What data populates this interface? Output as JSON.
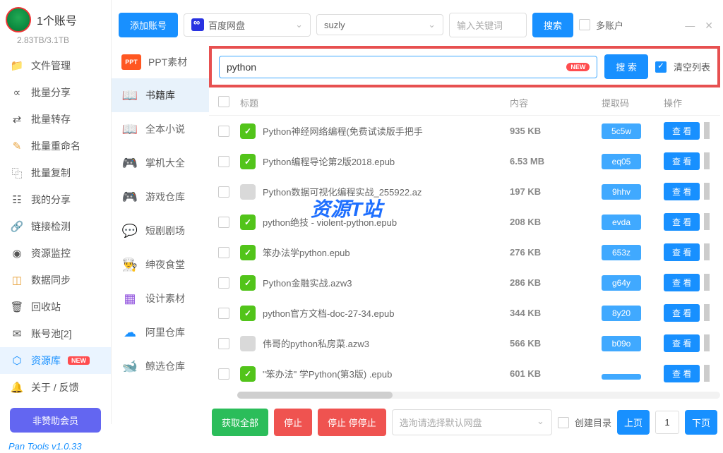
{
  "sidebar": {
    "account_label": "1个账号",
    "storage": "2.83TB/3.1TB",
    "items": [
      {
        "icon": "📁",
        "label": "文件管理",
        "color": "#e8a23c"
      },
      {
        "icon": "∝",
        "label": "批量分享",
        "color": "#555"
      },
      {
        "icon": "⇄",
        "label": "批量转存",
        "color": "#555"
      },
      {
        "icon": "✎",
        "label": "批量重命名",
        "color": "#e8a23c"
      },
      {
        "icon": "⿻",
        "label": "批量复制",
        "color": "#555"
      },
      {
        "icon": "☷",
        "label": "我的分享",
        "color": "#555"
      },
      {
        "icon": "🔗",
        "label": "链接检测",
        "color": "#555"
      },
      {
        "icon": "◉",
        "label": "资源监控",
        "color": "#555"
      },
      {
        "icon": "◫",
        "label": "数据同步",
        "color": "#e8a23c"
      },
      {
        "icon": "🗑",
        "label": "回收站",
        "color": "#555"
      },
      {
        "icon": "✉",
        "label": "账号池[2]",
        "color": "#555"
      },
      {
        "icon": "⬡",
        "label": "资源库",
        "color": "#1890ff",
        "active": true,
        "badge": "NEW"
      },
      {
        "icon": "🔔",
        "label": "关于 / 反馈",
        "color": "#555"
      }
    ],
    "member_btn": "非赞助会员",
    "version": "Pan Tools v1.0.33"
  },
  "categories": [
    {
      "label": "PPT素材",
      "iconColor": "#ff5722",
      "glyph": "PPT"
    },
    {
      "label": "书籍库",
      "iconColor": "#40a9ff",
      "glyph": "📖",
      "active": true
    },
    {
      "label": "全本小说",
      "iconColor": "#555",
      "glyph": "📖"
    },
    {
      "label": "掌机大全",
      "iconColor": "#ffc53d",
      "glyph": "🎮"
    },
    {
      "label": "游戏仓库",
      "iconColor": "#b037d9",
      "glyph": "🎮"
    },
    {
      "label": "短剧剧场",
      "iconColor": "#1890ff",
      "glyph": "💬"
    },
    {
      "label": "绅夜食堂",
      "iconColor": "#d4380d",
      "glyph": "👨‍🍳"
    },
    {
      "label": "设计素材",
      "iconColor": "#9254de",
      "glyph": "▦"
    },
    {
      "label": "阿里仓库",
      "iconColor": "#1890ff",
      "glyph": "☁"
    },
    {
      "label": "鲸选仓库",
      "iconColor": "#52c41a",
      "glyph": "🐋"
    }
  ],
  "topbar": {
    "add_account": "添加账号",
    "drive_label": "百度网盘",
    "user_label": "suzly",
    "keyword_placeholder": "输入关键词",
    "search_btn": "搜索",
    "multi_account": "多账户"
  },
  "search": {
    "value": "python",
    "badge": "NEW",
    "btn": "搜 索",
    "clear_label": "清空列表"
  },
  "table": {
    "headers": {
      "title": "标题",
      "content": "内容",
      "code": "提取码",
      "action": "操作"
    },
    "rows": [
      {
        "title": "Python神经网络编程(免费试读版手把手",
        "size": "935 KB",
        "code": "5c5w",
        "view": "查 看",
        "icon": "green"
      },
      {
        "title": "Python编程导论第2版2018.epub",
        "size": "6.53 MB",
        "code": "eq05",
        "view": "查 看",
        "icon": "green"
      },
      {
        "title": "Python数据可视化编程实战_255922.az",
        "size": "197 KB",
        "code": "9hhv",
        "view": "查 看",
        "icon": "gray"
      },
      {
        "title": "python绝技 - violent-python.epub",
        "size": "208 KB",
        "code": "evda",
        "view": "查 看",
        "icon": "green"
      },
      {
        "title": "笨办法学python.epub",
        "size": "276 KB",
        "code": "653z",
        "view": "查 看",
        "icon": "green"
      },
      {
        "title": "Python金融实战.azw3",
        "size": "286 KB",
        "code": "g64y",
        "view": "查 看",
        "icon": "green"
      },
      {
        "title": "python官方文档-doc-27-34.epub",
        "size": "344 KB",
        "code": "8y20",
        "view": "查 看",
        "icon": "green"
      },
      {
        "title": "伟哥的python私房菜.azw3",
        "size": "566 KB",
        "code": "b09o",
        "view": "查 看",
        "icon": "gray"
      },
      {
        "title": "\"笨办法\" 学Python(第3版) .epub",
        "size": "601 KB",
        "code": "",
        "view": "查 看",
        "icon": "green"
      }
    ]
  },
  "bottom": {
    "get_all": "获取全部",
    "stop": "停止",
    "stop2": "停止 停停止",
    "select_placeholder": "选洵请选择默认网盘",
    "create_dir": "创建目录",
    "prev": "上页",
    "page": "1",
    "next": "下页"
  },
  "watermark": "资源T站"
}
